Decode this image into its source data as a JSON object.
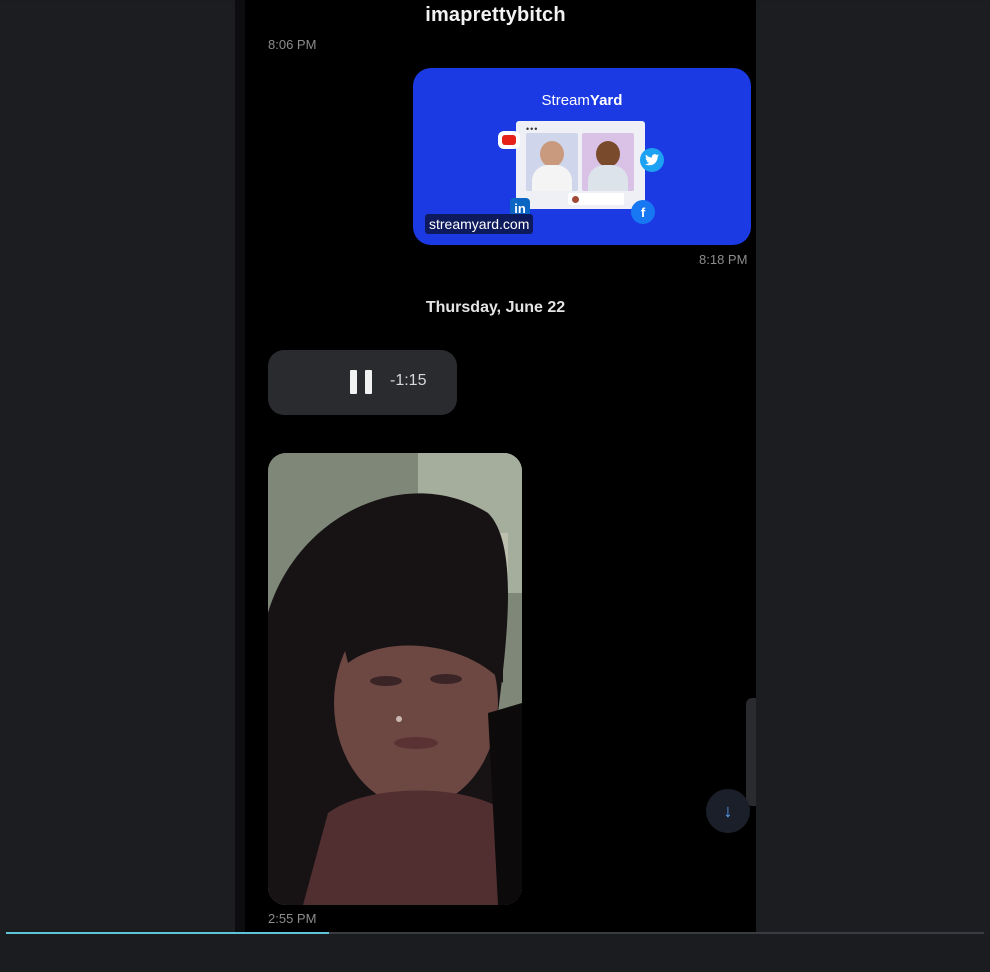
{
  "conversation": {
    "title": "imaprettybitch"
  },
  "messages": {
    "top_time": "8:06 PM",
    "link_preview": {
      "brand_prefix": "Stream",
      "brand_suffix": "Yard",
      "url": "streamyard.com",
      "time": "8:18 PM",
      "social_icons": [
        "youtube-icon",
        "twitter-icon",
        "linkedin-icon",
        "facebook-icon"
      ],
      "linkedin_label": "in",
      "facebook_label": "f"
    },
    "date_separator": "Thursday, June 22",
    "voice_message": {
      "remaining": "-1:15",
      "state": "playing"
    },
    "video_message": {
      "time": "2:55 PM"
    }
  },
  "player": {
    "progress": 0.33,
    "accent": "#5ec6d8"
  },
  "colors": {
    "link_card": "#1b3ae3",
    "bubble": "#2a2b2e",
    "background": "#000000"
  }
}
